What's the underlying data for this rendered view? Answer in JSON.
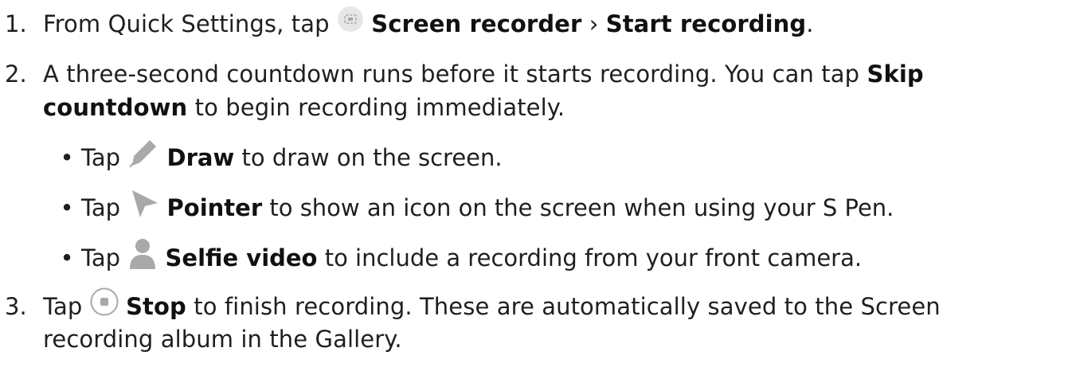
{
  "steps": [
    {
      "number": "1.",
      "pre": "From Quick Settings, tap",
      "icon": "screen-recorder-icon",
      "bold1": "Screen recorder",
      "sep": "›",
      "bold2": "Start recording",
      "post": "."
    },
    {
      "number": "2.",
      "line1_pre": "A three-second countdown runs before it starts recording. You can tap",
      "line1_bold": "Skip",
      "line2_bold": "countdown",
      "line2_post": "to begin recording immediately.",
      "bullets": [
        {
          "pre": "Tap",
          "icon": "draw-pencil-icon",
          "bold": "Draw",
          "post": "to draw on the screen."
        },
        {
          "pre": "Tap",
          "icon": "pointer-icon",
          "bold": "Pointer",
          "post": "to show an icon on the screen when using your S Pen."
        },
        {
          "pre": "Tap",
          "icon": "selfie-person-icon",
          "bold": "Selfie video",
          "post": "to include a recording from your front camera."
        }
      ]
    },
    {
      "number": "3.",
      "pre": "Tap",
      "icon": "stop-icon",
      "bold": "Stop",
      "line1_post": "to finish recording. These are automatically saved to the Screen",
      "line2": "recording album in the Gallery."
    }
  ],
  "colors": {
    "text": "#1f1f1f",
    "icon_gray": "#a9a9a9"
  }
}
